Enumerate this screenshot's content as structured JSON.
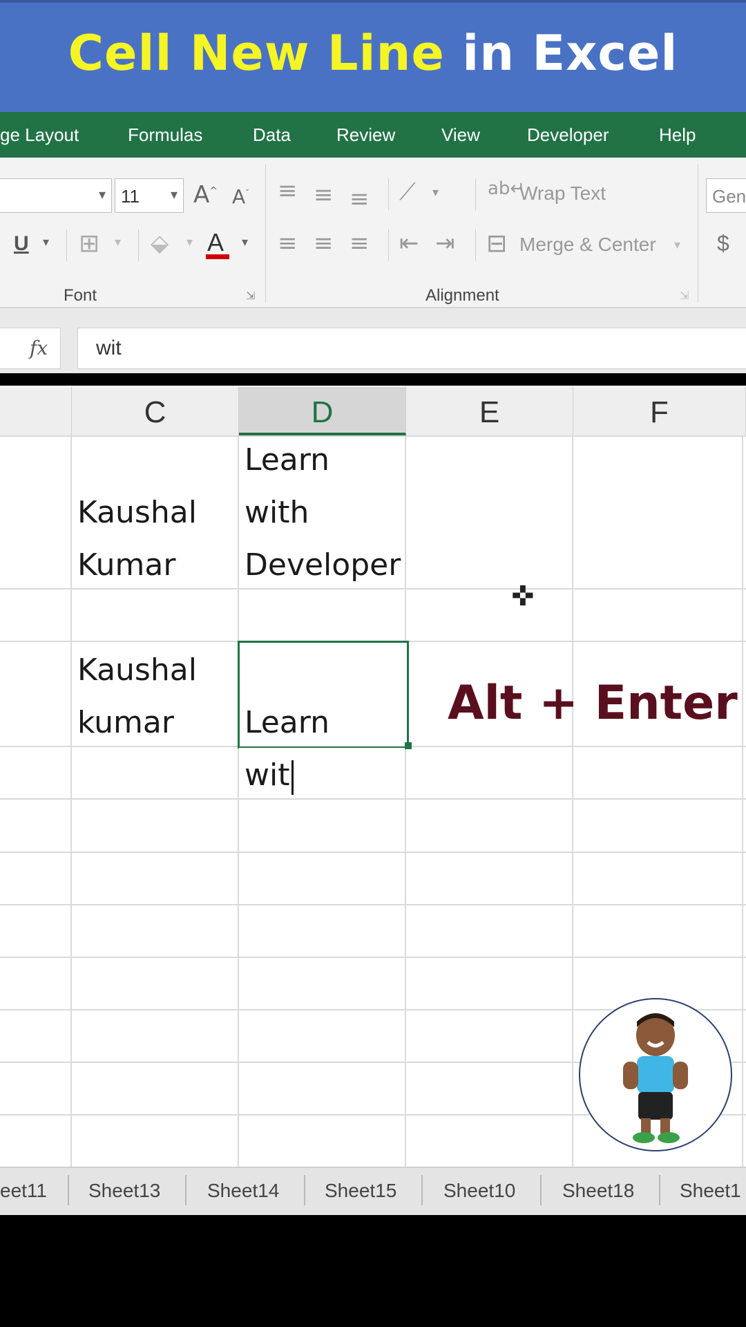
{
  "banner": {
    "title_part1": "Cell New Line",
    "title_part2": "in Excel"
  },
  "ribbon_tabs": [
    "ge Layout",
    "Formulas",
    "Data",
    "Review",
    "View",
    "Developer",
    "Help"
  ],
  "ribbon": {
    "font_size": "11",
    "font_group_label": "Font",
    "alignment_group_label": "Alignment",
    "wrap_text": "Wrap Text",
    "merge_center": "Merge & Center",
    "number_format_partial": "Gen",
    "currency_symbol": "$",
    "underline": "U",
    "font_color_letter": "A",
    "font_color_hex": "#d00000"
  },
  "formula_bar": {
    "fx_label": "fx",
    "value": "wit"
  },
  "columns": [
    "C",
    "D",
    "E",
    "F"
  ],
  "cells": {
    "c_row1_line1": "Kaushal",
    "c_row1_line2": "Kumar",
    "d_row1_line1": "Learn",
    "d_row1_line2": "with",
    "d_row1_line3": "Developer",
    "c_row3_line1": "Kaushal",
    "c_row3_line2": "kumar",
    "d_row3_line2": "Learn",
    "d_row3_line3": "wit"
  },
  "overlay": {
    "shortcut": "Alt + Enter"
  },
  "sheet_tabs": [
    "eet11",
    "Sheet13",
    "Sheet14",
    "Sheet15",
    "Sheet10",
    "Sheet18",
    "Sheet1"
  ],
  "colors": {
    "banner": "#4a72c4",
    "tabbar": "#217346",
    "title_yellow": "#f5f525",
    "shortcut_text": "#5a0f1e",
    "selection": "#217346"
  }
}
